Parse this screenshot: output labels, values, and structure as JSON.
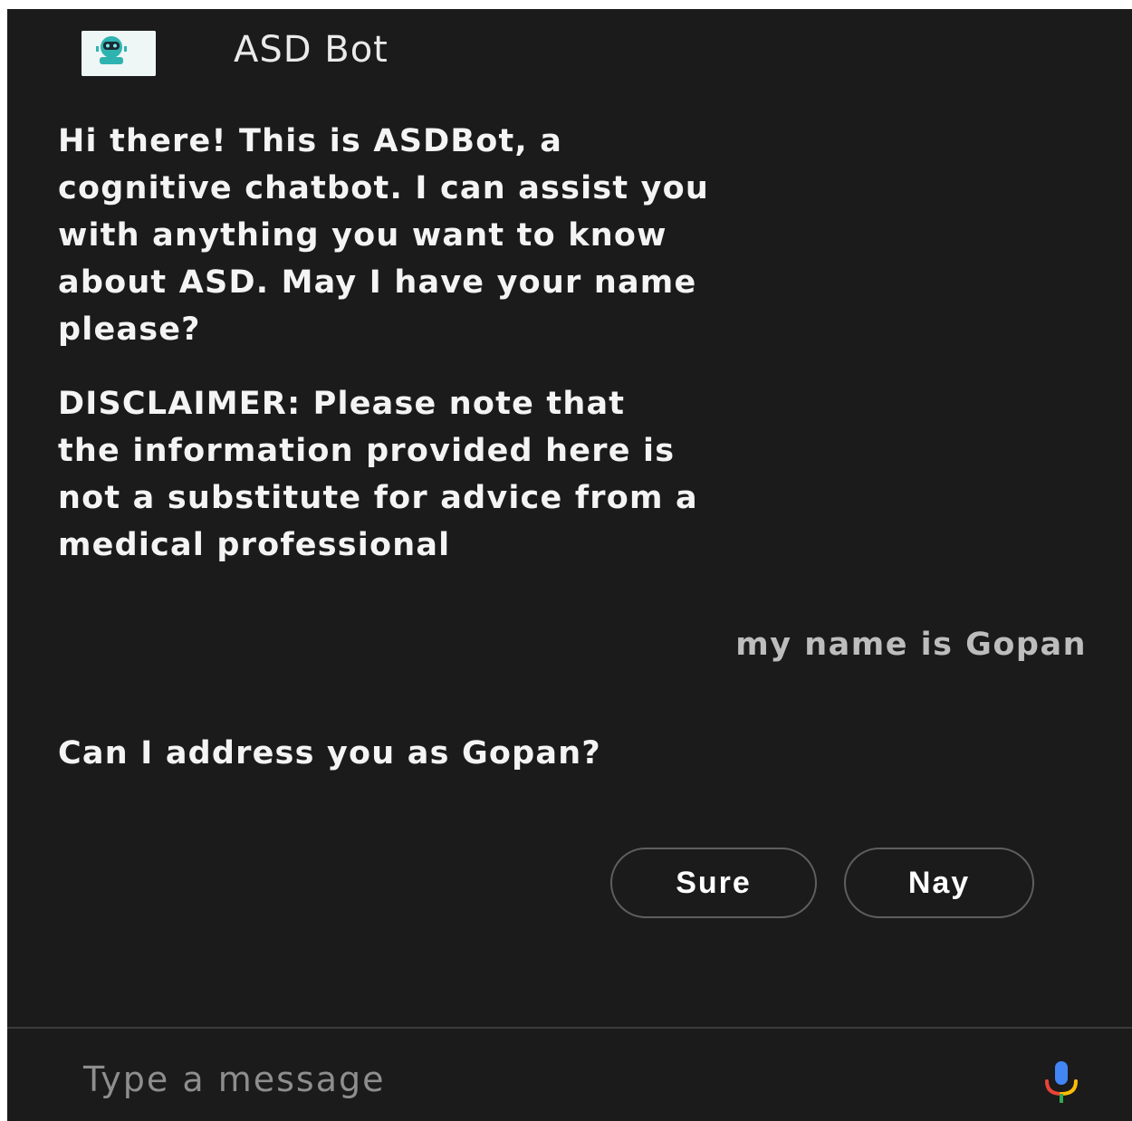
{
  "header": {
    "title": "ASD Bot",
    "logo_text": "ASDBot"
  },
  "messages": {
    "bot_greeting": [
      "Hi there! This is ASDBot, a",
      "cognitive chatbot. I can assist you",
      "with anything you want to know",
      "about ASD. May I have your name",
      "please?"
    ],
    "bot_disclaimer": [
      "DISCLAIMER: Please note that",
      "the information provided here is",
      "not a substitute for advice from a",
      "medical professional"
    ],
    "user_reply": "my name is Gopan",
    "bot_question": "Can I address you as Gopan?"
  },
  "suggestions": {
    "sure": "Sure",
    "nay": "Nay"
  },
  "composer": {
    "placeholder": "Type a message",
    "mic_icon": "microphone-icon"
  },
  "colors": {
    "background": "#1b1b1c",
    "text": "#f4f4f4",
    "user_text": "#bdbdbd",
    "chip_border": "#5f5f5f"
  }
}
